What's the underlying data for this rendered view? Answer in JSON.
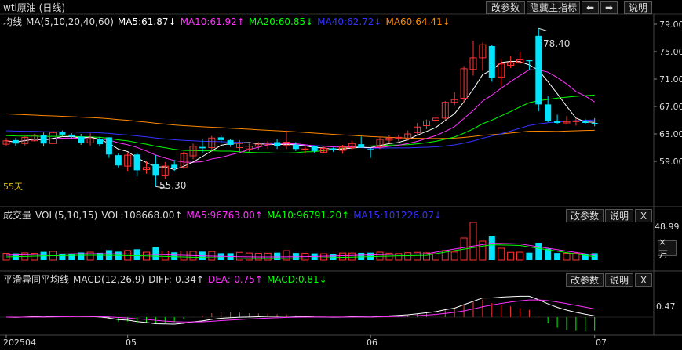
{
  "title": {
    "name": "wti原油 (日线)"
  },
  "top_buttons": {
    "params": "改参数",
    "hide": "隐藏主指标",
    "left": "⬅",
    "right": "➡",
    "help": "说明"
  },
  "main": {
    "label": "均线",
    "indicator": "MA(5,10,20,40,60)",
    "ma5": "MA5:61.87↓",
    "ma10": "MA10:61.92↑",
    "ma20": "MA20:60.85↓",
    "ma40": "MA40:62.72↓",
    "ma60": "MA60:64.41↓",
    "yticks": [
      "79.00",
      "75.00",
      "71.00",
      "67.00",
      "63.00",
      "59.00"
    ],
    "high_label": "78.40",
    "low_label": "55.30",
    "period": "55天"
  },
  "volume": {
    "label": "成交量",
    "indicator": "VOL(5,10,15)",
    "vol": "VOL:108668.00↑",
    "ma5": "MA5:96763.00↑",
    "ma10": "MA10:96791.20↑",
    "ma15": "MA15:101226.07↓",
    "params": "改参数",
    "help": "说明",
    "close": "X",
    "ytick": "48.99",
    "unit": "×万"
  },
  "macd": {
    "label": "平滑异同平均线",
    "indicator": "MACD(12,26,9)",
    "diff": "DIFF:-0.34↑",
    "dea": "DEA:-0.75↑",
    "macd": "MACD:0.81↓",
    "params": "改参数",
    "help": "说明",
    "close": "X",
    "ytick": "0.47"
  },
  "xaxis": [
    "202504",
    "05",
    "06",
    "07"
  ],
  "colors": {
    "up": "#ff3232",
    "down": "#00e5ff",
    "ma5": "#ffffff",
    "ma10": "#ff33ff",
    "ma20": "#00ff00",
    "ma40": "#3333ff",
    "ma60": "#ff8800"
  },
  "chart_data": {
    "type": "candlestick",
    "candles": [
      [
        61.5,
        62.4,
        61.3,
        62.0
      ],
      [
        62.1,
        62.4,
        61.3,
        61.6
      ],
      [
        61.6,
        62.7,
        61.3,
        62.5
      ],
      [
        62.0,
        63.0,
        61.9,
        62.8
      ],
      [
        62.8,
        63.2,
        61.2,
        61.6
      ],
      [
        61.6,
        63.5,
        61.2,
        63.2
      ],
      [
        63.3,
        63.5,
        62.6,
        62.9
      ],
      [
        62.9,
        63.1,
        62.3,
        62.6
      ],
      [
        62.6,
        63.0,
        61.4,
        61.7
      ],
      [
        61.7,
        63.1,
        61.3,
        62.3
      ],
      [
        62.3,
        62.6,
        61.2,
        61.5
      ],
      [
        62.5,
        62.5,
        59.5,
        60.0
      ],
      [
        59.9,
        60.2,
        58.1,
        58.4
      ],
      [
        58.3,
        60.3,
        57.5,
        59.9
      ],
      [
        60.0,
        60.3,
        56.8,
        57.7
      ],
      [
        57.8,
        59.0,
        57.2,
        58.1
      ],
      [
        58.6,
        59.9,
        55.3,
        56.9
      ],
      [
        56.9,
        58.9,
        56.4,
        58.3
      ],
      [
        58.5,
        59.2,
        57.5,
        58.0
      ],
      [
        58.1,
        60.4,
        57.9,
        60.1
      ],
      [
        59.8,
        61.6,
        59.3,
        61.2
      ],
      [
        61.1,
        62.3,
        60.2,
        60.9
      ],
      [
        61.0,
        62.7,
        60.5,
        62.4
      ],
      [
        62.5,
        62.8,
        61.6,
        62.1
      ],
      [
        62.1,
        62.3,
        61.1,
        61.4
      ],
      [
        61.0,
        62.1,
        60.4,
        61.6
      ],
      [
        60.8,
        61.6,
        60.3,
        61.2
      ],
      [
        61.2,
        61.8,
        60.7,
        61.5
      ],
      [
        61.5,
        62.0,
        60.8,
        61.7
      ],
      [
        61.8,
        62.3,
        60.8,
        61.2
      ],
      [
        61.3,
        63.5,
        60.8,
        61.8
      ],
      [
        61.4,
        61.8,
        60.5,
        60.8
      ],
      [
        60.8,
        61.2,
        60.1,
        60.8
      ],
      [
        61.2,
        61.3,
        60.2,
        60.5
      ],
      [
        60.3,
        61.1,
        60.2,
        60.9
      ],
      [
        60.9,
        61.0,
        60.4,
        60.6
      ],
      [
        60.6,
        61.4,
        60.1,
        61.1
      ],
      [
        61.0,
        62.0,
        60.7,
        61.6
      ],
      [
        61.5,
        62.6,
        61.2,
        61.0
      ],
      [
        60.8,
        61.0,
        59.5,
        60.7
      ],
      [
        61.1,
        62.6,
        60.8,
        62.2
      ],
      [
        62.1,
        62.8,
        61.6,
        62.4
      ],
      [
        62.4,
        62.9,
        61.9,
        62.5
      ],
      [
        62.3,
        63.5,
        62.0,
        63.0
      ],
      [
        63.2,
        64.6,
        62.9,
        64.0
      ],
      [
        64.2,
        65.1,
        63.7,
        64.9
      ],
      [
        65.0,
        65.5,
        64.6,
        65.3
      ],
      [
        65.3,
        67.8,
        65.0,
        67.6
      ],
      [
        67.6,
        69.1,
        67.2,
        68.0
      ],
      [
        68.2,
        72.9,
        67.5,
        72.5
      ],
      [
        72.4,
        76.6,
        71.5,
        74.1
      ],
      [
        74.1,
        76.3,
        72.2,
        76.0
      ],
      [
        75.8,
        76.0,
        70.6,
        71.2
      ],
      [
        71.3,
        74.0,
        69.9,
        73.2
      ],
      [
        73.0,
        74.3,
        72.6,
        73.4
      ],
      [
        73.4,
        75.0,
        73.2,
        73.9
      ],
      [
        73.8,
        73.8,
        72.3,
        73.6
      ],
      [
        77.3,
        78.4,
        66.3,
        67.3
      ],
      [
        67.3,
        68.5,
        64.7,
        64.9
      ],
      [
        64.9,
        65.8,
        64.5,
        64.6
      ],
      [
        64.6,
        65.6,
        64.5,
        64.8
      ],
      [
        64.9,
        65.3,
        64.2,
        64.9
      ],
      [
        64.8,
        65.2,
        64.5,
        64.6
      ],
      [
        64.6,
        65.3,
        64.1,
        64.5
      ]
    ]
  }
}
